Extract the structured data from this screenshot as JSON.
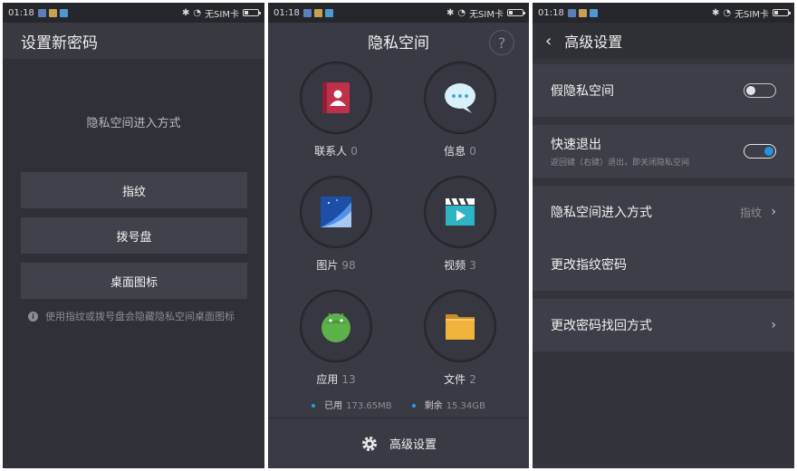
{
  "status": {
    "time": "01:18",
    "carrier": "无SIM卡"
  },
  "screen1": {
    "title": "设置新密码",
    "caption": "隐私空间进入方式",
    "options": [
      "指纹",
      "拨号盘",
      "桌面图标"
    ],
    "hint": "使用指纹或拨号盘会隐藏隐私空间桌面图标"
  },
  "screen2": {
    "title": "隐私空间",
    "help": "?",
    "apps": [
      {
        "label": "联系人",
        "count": "0",
        "icon": "contacts-icon"
      },
      {
        "label": "信息",
        "count": "0",
        "icon": "messages-icon"
      },
      {
        "label": "图片",
        "count": "98",
        "icon": "gallery-icon"
      },
      {
        "label": "视频",
        "count": "3",
        "icon": "video-icon"
      },
      {
        "label": "应用",
        "count": "13",
        "icon": "android-icon"
      },
      {
        "label": "文件",
        "count": "2",
        "icon": "folder-icon"
      }
    ],
    "used_label": "已用",
    "used_value": "173.65MB",
    "free_label": "剩余",
    "free_value": "15.34GB",
    "advanced": "高级设置"
  },
  "screen3": {
    "title": "高级设置",
    "fake_space": {
      "label": "假隐私空间",
      "on": false
    },
    "quick_exit": {
      "label": "快速退出",
      "sub": "返回键（右键）退出，即关闭隐私空间",
      "on": true
    },
    "entry_method": {
      "label": "隐私空间进入方式",
      "value": "指纹"
    },
    "change_fingerprint": "更改指纹密码",
    "recovery": "更改密码找回方式"
  },
  "colors": {
    "accent": "#2392e0",
    "storage_dot": "#2a9de0"
  }
}
